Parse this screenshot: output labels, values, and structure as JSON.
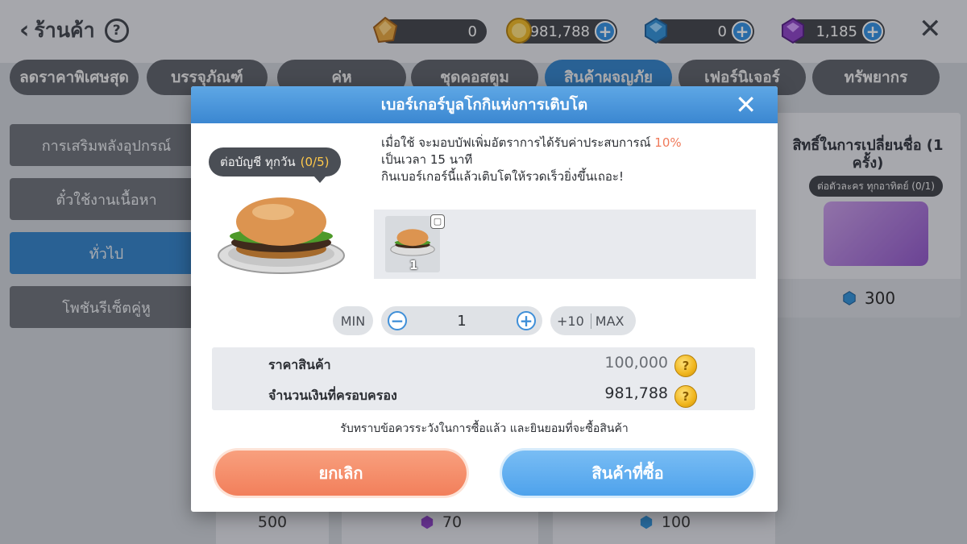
{
  "header": {
    "back_label": "ร้านค้า",
    "help_glyph": "?",
    "close_glyph": "✕",
    "currencies": [
      {
        "icon": "amber-crystal-icon",
        "value": "0",
        "has_plus": false
      },
      {
        "icon": "gold-coin-icon",
        "value": "981,788",
        "has_plus": true
      },
      {
        "icon": "blue-gem-icon",
        "value": "0",
        "has_plus": true
      },
      {
        "icon": "purple-gem-icon",
        "value": "1,185",
        "has_plus": true
      }
    ]
  },
  "tabs": [
    {
      "label": "ลดราคาพิเศษสุด"
    },
    {
      "label": "บรรจุภัณฑ์"
    },
    {
      "label": "ค่ห"
    },
    {
      "label": "ชุดคอสตูม"
    },
    {
      "label": "สินค้าผจญภัย",
      "active": true
    },
    {
      "label": "เฟอร์นิเจอร์"
    },
    {
      "label": "ทรัพยากร"
    }
  ],
  "sidebar": [
    {
      "label": "การเสริมพลังอุปกรณ์"
    },
    {
      "label": "ตั๋วใช้งานเนื้อหา"
    },
    {
      "label": "ทั่วไป",
      "active": true
    },
    {
      "label": "โพชันรีเซ็ตคู่หู"
    }
  ],
  "right_card": {
    "title": "สิทธิ์ในการเปลี่ยนชื่อ (1 ครั้ง)",
    "tag": "ต่อตัวละคร ทุกอาทิตย์ (0/1)",
    "price": "300"
  },
  "bottom_cards": [
    {
      "price": "500"
    },
    {
      "price": "70"
    },
    {
      "price": "100"
    }
  ],
  "dialog": {
    "title": "เบอร์เกอร์บูลโกกิแห่งการเติบโต",
    "close_glyph": "✕",
    "limit_label": "ต่อบัญชี ทุกวัน",
    "limit_count": "(0/5)",
    "desc_line1_a": "เมื่อใช้ จะมอบบัฟเพิ่มอัตราการได้รับค่าประสบการณ์",
    "desc_line1_highlight": "10%",
    "desc_line2": "เป็นเวลา 15 นาที",
    "desc_line3": "กินเบอร์เกอร์นี้แล้วเติบโตให้รวดเร็วยิ่งขึ้นเถอะ!",
    "item_qty": "1",
    "min_label": "MIN",
    "minus_glyph": "−",
    "quantity": "1",
    "plus_glyph": "+",
    "plus10_label": "+10",
    "max_label": "MAX",
    "price_label": "ราคาสินค้า",
    "price_value": "100,000",
    "owned_label": "จำนวนเงินที่ครอบครอง",
    "owned_value": "981,788",
    "coin_glyph": "?",
    "agree_text": "รับทราบข้อควรระวังในการซื้อแล้ว และยินยอมที่จะซื้อสินค้า",
    "cancel_label": "ยกเลิก",
    "buy_label": "สินค้าที่ซื้อ"
  },
  "colors": {
    "accent_blue": "#3b87d1",
    "cancel_orange": "#f27f5b",
    "highlight": "#f07a5a",
    "limit_count": "#ffc94a"
  }
}
